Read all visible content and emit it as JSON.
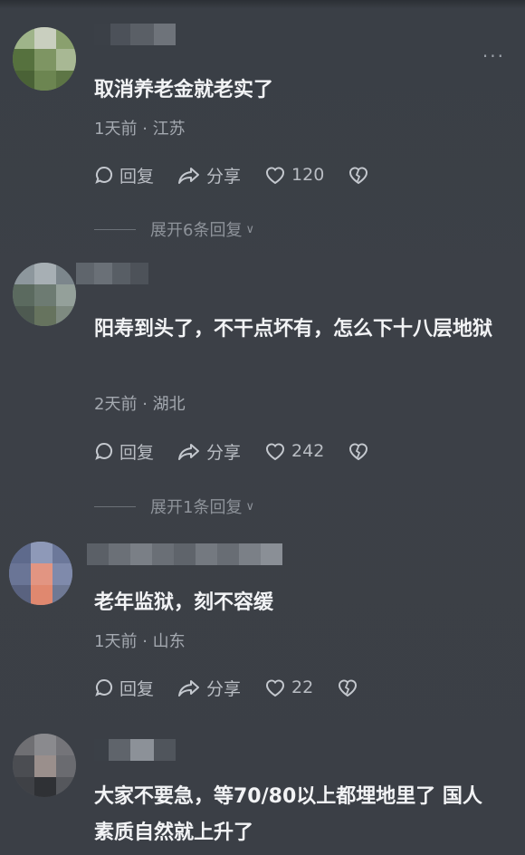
{
  "comments": [
    {
      "text": "取消养老金就老实了",
      "date": "1天前",
      "location": "江苏",
      "reply_label": "回复",
      "share_label": "分享",
      "likes": "120",
      "expand_label": "展开6条回复"
    },
    {
      "text": "阳寿到头了，不干点坏有，怎么下十八层地狱",
      "date": "2天前",
      "location": "湖北",
      "reply_label": "回复",
      "share_label": "分享",
      "likes": "242",
      "expand_label": "展开1条回复"
    },
    {
      "text": "老年监狱，刻不容缓",
      "date": "1天前",
      "location": "山东",
      "reply_label": "回复",
      "share_label": "分享",
      "likes": "22"
    },
    {
      "text": "大家不要急，等70/80以上都埋地里了 国人素质自然就上升了"
    }
  ],
  "separator": "·",
  "more_icon": "more-dots-icon",
  "colors": {
    "background": "#3c4047",
    "text": "#f2f3f5",
    "meta": "#a4a9b0"
  }
}
